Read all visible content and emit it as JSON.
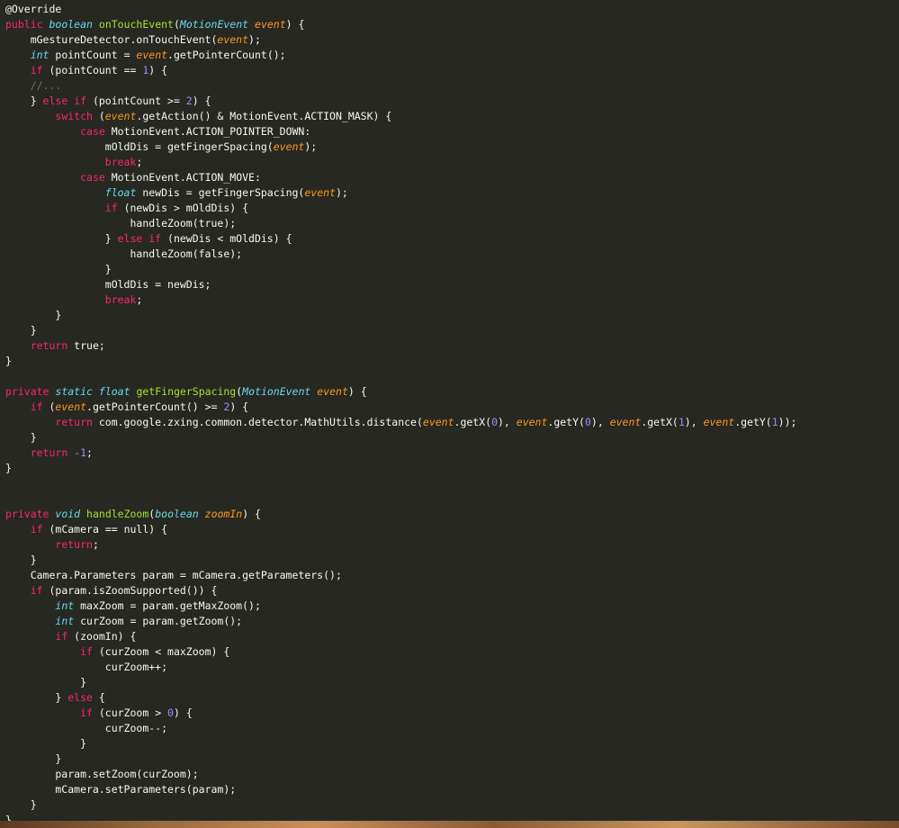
{
  "editor": {
    "lines": [
      [
        [
          "pl",
          "@Override"
        ]
      ],
      [
        [
          "kw",
          "public"
        ],
        [
          "pl",
          " "
        ],
        [
          "ty",
          "boolean"
        ],
        [
          "pl",
          " "
        ],
        [
          "fn",
          "onTouchEvent"
        ],
        [
          "pl",
          "("
        ],
        [
          "ty",
          "MotionEvent"
        ],
        [
          "pl",
          " "
        ],
        [
          "pm",
          "event"
        ],
        [
          "pl",
          ") {"
        ]
      ],
      [
        [
          "pl",
          "    mGestureDetector.onTouchEvent("
        ],
        [
          "pm",
          "event"
        ],
        [
          "pl",
          ");"
        ]
      ],
      [
        [
          "pl",
          "    "
        ],
        [
          "ty",
          "int"
        ],
        [
          "pl",
          " pointCount = "
        ],
        [
          "pm",
          "event"
        ],
        [
          "pl",
          ".getPointerCount();"
        ]
      ],
      [
        [
          "pl",
          "    "
        ],
        [
          "kw",
          "if"
        ],
        [
          "pl",
          " (pointCount == "
        ],
        [
          "nm",
          "1"
        ],
        [
          "pl",
          ") {"
        ]
      ],
      [
        [
          "pl",
          "    "
        ],
        [
          "cm",
          "//..."
        ]
      ],
      [
        [
          "pl",
          "    } "
        ],
        [
          "kw",
          "else if"
        ],
        [
          "pl",
          " (pointCount >= "
        ],
        [
          "nm",
          "2"
        ],
        [
          "pl",
          ") {"
        ]
      ],
      [
        [
          "pl",
          "        "
        ],
        [
          "kw",
          "switch"
        ],
        [
          "pl",
          " ("
        ],
        [
          "pm",
          "event"
        ],
        [
          "pl",
          ".getAction() & MotionEvent.ACTION_MASK) {"
        ]
      ],
      [
        [
          "pl",
          "            "
        ],
        [
          "kw",
          "case"
        ],
        [
          "pl",
          " MotionEvent.ACTION_POINTER_DOWN:"
        ]
      ],
      [
        [
          "pl",
          "                mOldDis = getFingerSpacing("
        ],
        [
          "pm",
          "event"
        ],
        [
          "pl",
          ");"
        ]
      ],
      [
        [
          "pl",
          "                "
        ],
        [
          "kw",
          "break"
        ],
        [
          "pl",
          ";"
        ]
      ],
      [
        [
          "pl",
          "            "
        ],
        [
          "kw",
          "case"
        ],
        [
          "pl",
          " MotionEvent.ACTION_MOVE:"
        ]
      ],
      [
        [
          "pl",
          "                "
        ],
        [
          "ty",
          "float"
        ],
        [
          "pl",
          " newDis = getFingerSpacing("
        ],
        [
          "pm",
          "event"
        ],
        [
          "pl",
          ");"
        ]
      ],
      [
        [
          "pl",
          "                "
        ],
        [
          "kw",
          "if"
        ],
        [
          "pl",
          " (newDis > mOldDis) {"
        ]
      ],
      [
        [
          "pl",
          "                    handleZoom(true);"
        ]
      ],
      [
        [
          "pl",
          "                } "
        ],
        [
          "kw",
          "else if"
        ],
        [
          "pl",
          " (newDis < mOldDis) {"
        ]
      ],
      [
        [
          "pl",
          "                    handleZoom(false);"
        ]
      ],
      [
        [
          "pl",
          "                }"
        ]
      ],
      [
        [
          "pl",
          "                mOldDis = newDis;"
        ]
      ],
      [
        [
          "pl",
          "                "
        ],
        [
          "kw",
          "break"
        ],
        [
          "pl",
          ";"
        ]
      ],
      [
        [
          "pl",
          "        }"
        ]
      ],
      [
        [
          "pl",
          "    }"
        ]
      ],
      [
        [
          "pl",
          "    "
        ],
        [
          "kw",
          "return"
        ],
        [
          "pl",
          " true;"
        ]
      ],
      [
        [
          "pl",
          "}"
        ]
      ],
      [],
      [
        [
          "kw",
          "private"
        ],
        [
          "pl",
          " "
        ],
        [
          "ty",
          "static"
        ],
        [
          "pl",
          " "
        ],
        [
          "ty",
          "float"
        ],
        [
          "pl",
          " "
        ],
        [
          "fn",
          "getFingerSpacing"
        ],
        [
          "pl",
          "("
        ],
        [
          "ty",
          "MotionEvent"
        ],
        [
          "pl",
          " "
        ],
        [
          "pm",
          "event"
        ],
        [
          "pl",
          ") {"
        ]
      ],
      [
        [
          "pl",
          "    "
        ],
        [
          "kw",
          "if"
        ],
        [
          "pl",
          " ("
        ],
        [
          "pm",
          "event"
        ],
        [
          "pl",
          ".getPointerCount() >= "
        ],
        [
          "nm",
          "2"
        ],
        [
          "pl",
          ") {"
        ]
      ],
      [
        [
          "pl",
          "        "
        ],
        [
          "kw",
          "return"
        ],
        [
          "pl",
          " com.google.zxing.common.detector.MathUtils.distance("
        ],
        [
          "pm",
          "event"
        ],
        [
          "pl",
          ".getX("
        ],
        [
          "nm",
          "0"
        ],
        [
          "pl",
          "), "
        ],
        [
          "pm",
          "event"
        ],
        [
          "pl",
          ".getY("
        ],
        [
          "nm",
          "0"
        ],
        [
          "pl",
          "), "
        ],
        [
          "pm",
          "event"
        ],
        [
          "pl",
          ".getX("
        ],
        [
          "nm",
          "1"
        ],
        [
          "pl",
          "), "
        ],
        [
          "pm",
          "event"
        ],
        [
          "pl",
          ".getY("
        ],
        [
          "nm",
          "1"
        ],
        [
          "pl",
          "));"
        ]
      ],
      [
        [
          "pl",
          "    }"
        ]
      ],
      [
        [
          "pl",
          "    "
        ],
        [
          "kw",
          "return"
        ],
        [
          "pl",
          " "
        ],
        [
          "nm",
          "-1"
        ],
        [
          "pl",
          ";"
        ]
      ],
      [
        [
          "pl",
          "}"
        ]
      ],
      [],
      [],
      [
        [
          "kw",
          "private"
        ],
        [
          "pl",
          " "
        ],
        [
          "ty",
          "void"
        ],
        [
          "pl",
          " "
        ],
        [
          "fn",
          "handleZoom"
        ],
        [
          "pl",
          "("
        ],
        [
          "ty",
          "boolean"
        ],
        [
          "pl",
          " "
        ],
        [
          "pm",
          "zoomIn"
        ],
        [
          "pl",
          ") {"
        ]
      ],
      [
        [
          "pl",
          "    "
        ],
        [
          "kw",
          "if"
        ],
        [
          "pl",
          " (mCamera == null) {"
        ]
      ],
      [
        [
          "pl",
          "        "
        ],
        [
          "kw",
          "return"
        ],
        [
          "pl",
          ";"
        ]
      ],
      [
        [
          "pl",
          "    }"
        ]
      ],
      [
        [
          "pl",
          "    Camera.Parameters param = mCamera.getParameters();"
        ]
      ],
      [
        [
          "pl",
          "    "
        ],
        [
          "kw",
          "if"
        ],
        [
          "pl",
          " (param.isZoomSupported()) {"
        ]
      ],
      [
        [
          "pl",
          "        "
        ],
        [
          "ty",
          "int"
        ],
        [
          "pl",
          " maxZoom = param.getMaxZoom();"
        ]
      ],
      [
        [
          "pl",
          "        "
        ],
        [
          "ty",
          "int"
        ],
        [
          "pl",
          " curZoom = param.getZoom();"
        ]
      ],
      [
        [
          "pl",
          "        "
        ],
        [
          "kw",
          "if"
        ],
        [
          "pl",
          " (zoomIn) {"
        ]
      ],
      [
        [
          "pl",
          "            "
        ],
        [
          "kw",
          "if"
        ],
        [
          "pl",
          " (curZoom < maxZoom) {"
        ]
      ],
      [
        [
          "pl",
          "                curZoom++;"
        ]
      ],
      [
        [
          "pl",
          "            }"
        ]
      ],
      [
        [
          "pl",
          "        } "
        ],
        [
          "kw",
          "else"
        ],
        [
          "pl",
          " {"
        ]
      ],
      [
        [
          "pl",
          "            "
        ],
        [
          "kw",
          "if"
        ],
        [
          "pl",
          " (curZoom > "
        ],
        [
          "nm",
          "0"
        ],
        [
          "pl",
          ") {"
        ]
      ],
      [
        [
          "pl",
          "                curZoom--;"
        ]
      ],
      [
        [
          "pl",
          "            }"
        ]
      ],
      [
        [
          "pl",
          "        }"
        ]
      ],
      [
        [
          "pl",
          "        param.setZoom(curZoom);"
        ]
      ],
      [
        [
          "pl",
          "        mCamera.setParameters(param);"
        ]
      ],
      [
        [
          "pl",
          "    }"
        ]
      ],
      [
        [
          "pl",
          "}"
        ]
      ]
    ]
  }
}
